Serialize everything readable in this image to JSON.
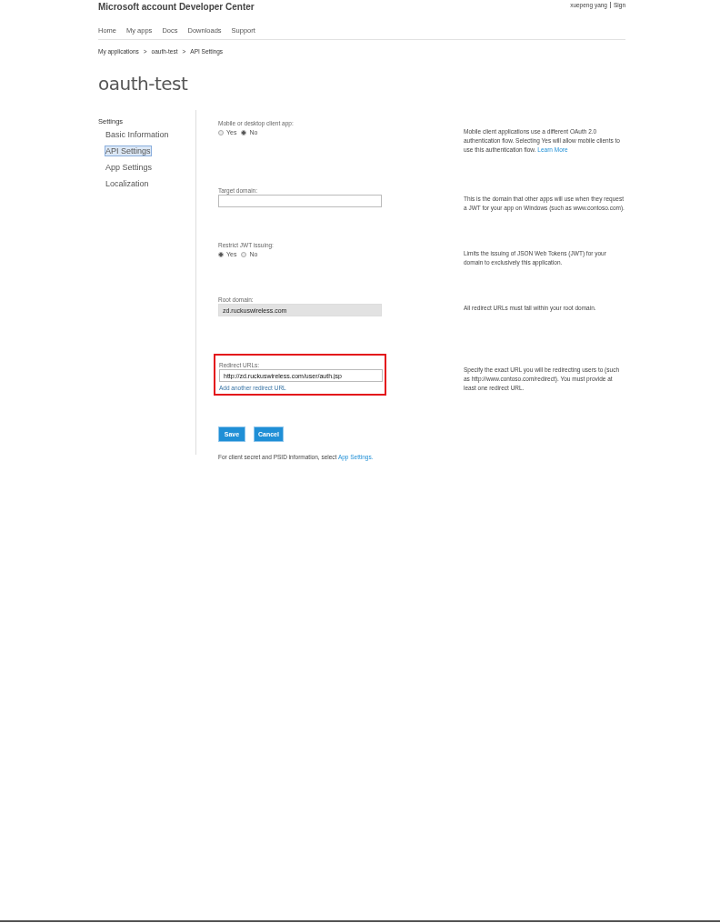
{
  "header": {
    "title": "Microsoft account Developer Center",
    "user_name": "xuepeng yang",
    "sign_link": "Sign"
  },
  "nav": [
    "Home",
    "My apps",
    "Docs",
    "Downloads",
    "Support"
  ],
  "breadcrumb": {
    "items": [
      "My applications",
      "oauth-test",
      "API Settings"
    ],
    "separator": ">"
  },
  "page_title": "oauth-test",
  "sidebar": {
    "heading": "Settings",
    "items": [
      {
        "label": "Basic Information",
        "selected": false
      },
      {
        "label": "API Settings",
        "selected": true
      },
      {
        "label": "App Settings",
        "selected": false
      },
      {
        "label": "Localization",
        "selected": false
      }
    ]
  },
  "fields": [
    {
      "kind": "radio",
      "label": "Mobile or desktop client app:",
      "highlighted": false,
      "options": [
        {
          "label": "Yes",
          "selected": false
        },
        {
          "label": "No",
          "selected": true
        }
      ],
      "description": "Mobile client applications use a different OAuth 2.0 authentication flow. Selecting Yes will allow mobile clients to use this authentication flow.",
      "description_link": "Learn More"
    },
    {
      "kind": "text",
      "label": "Target domain:",
      "highlighted": false,
      "disabled": false,
      "description": "This is the domain that other apps will use when they request a JWT for your app on Windows (such as www.contoso.com)."
    },
    {
      "kind": "radio",
      "label": "Restrict JWT issuing:",
      "highlighted": false,
      "options": [
        {
          "label": "Yes",
          "selected": true
        },
        {
          "label": "No",
          "selected": false
        }
      ],
      "description": "Limits the issuing of JSON Web Tokens (JWT) for your domain to exclusively this application."
    },
    {
      "kind": "text",
      "label": "Root domain:",
      "highlighted": false,
      "disabled": true,
      "value": "zd.ruckuswireless.com",
      "description": "All redirect URLs must fall within your root domain."
    },
    {
      "kind": "text",
      "label": "Redirect URLs:",
      "highlighted": true,
      "disabled": false,
      "value": "http://zd.ruckuswireless.com/user/auth.jsp",
      "add_link": "Add another redirect URL",
      "description": "Specify the exact URL you will be redirecting users to (such as http://www.contoso.com/redirect). You must provide at least one redirect URL."
    }
  ],
  "buttons": [
    "Save",
    "Cancel"
  ],
  "footer": {
    "text": "For client secret and PSID information, select",
    "link": "App Settings."
  }
}
